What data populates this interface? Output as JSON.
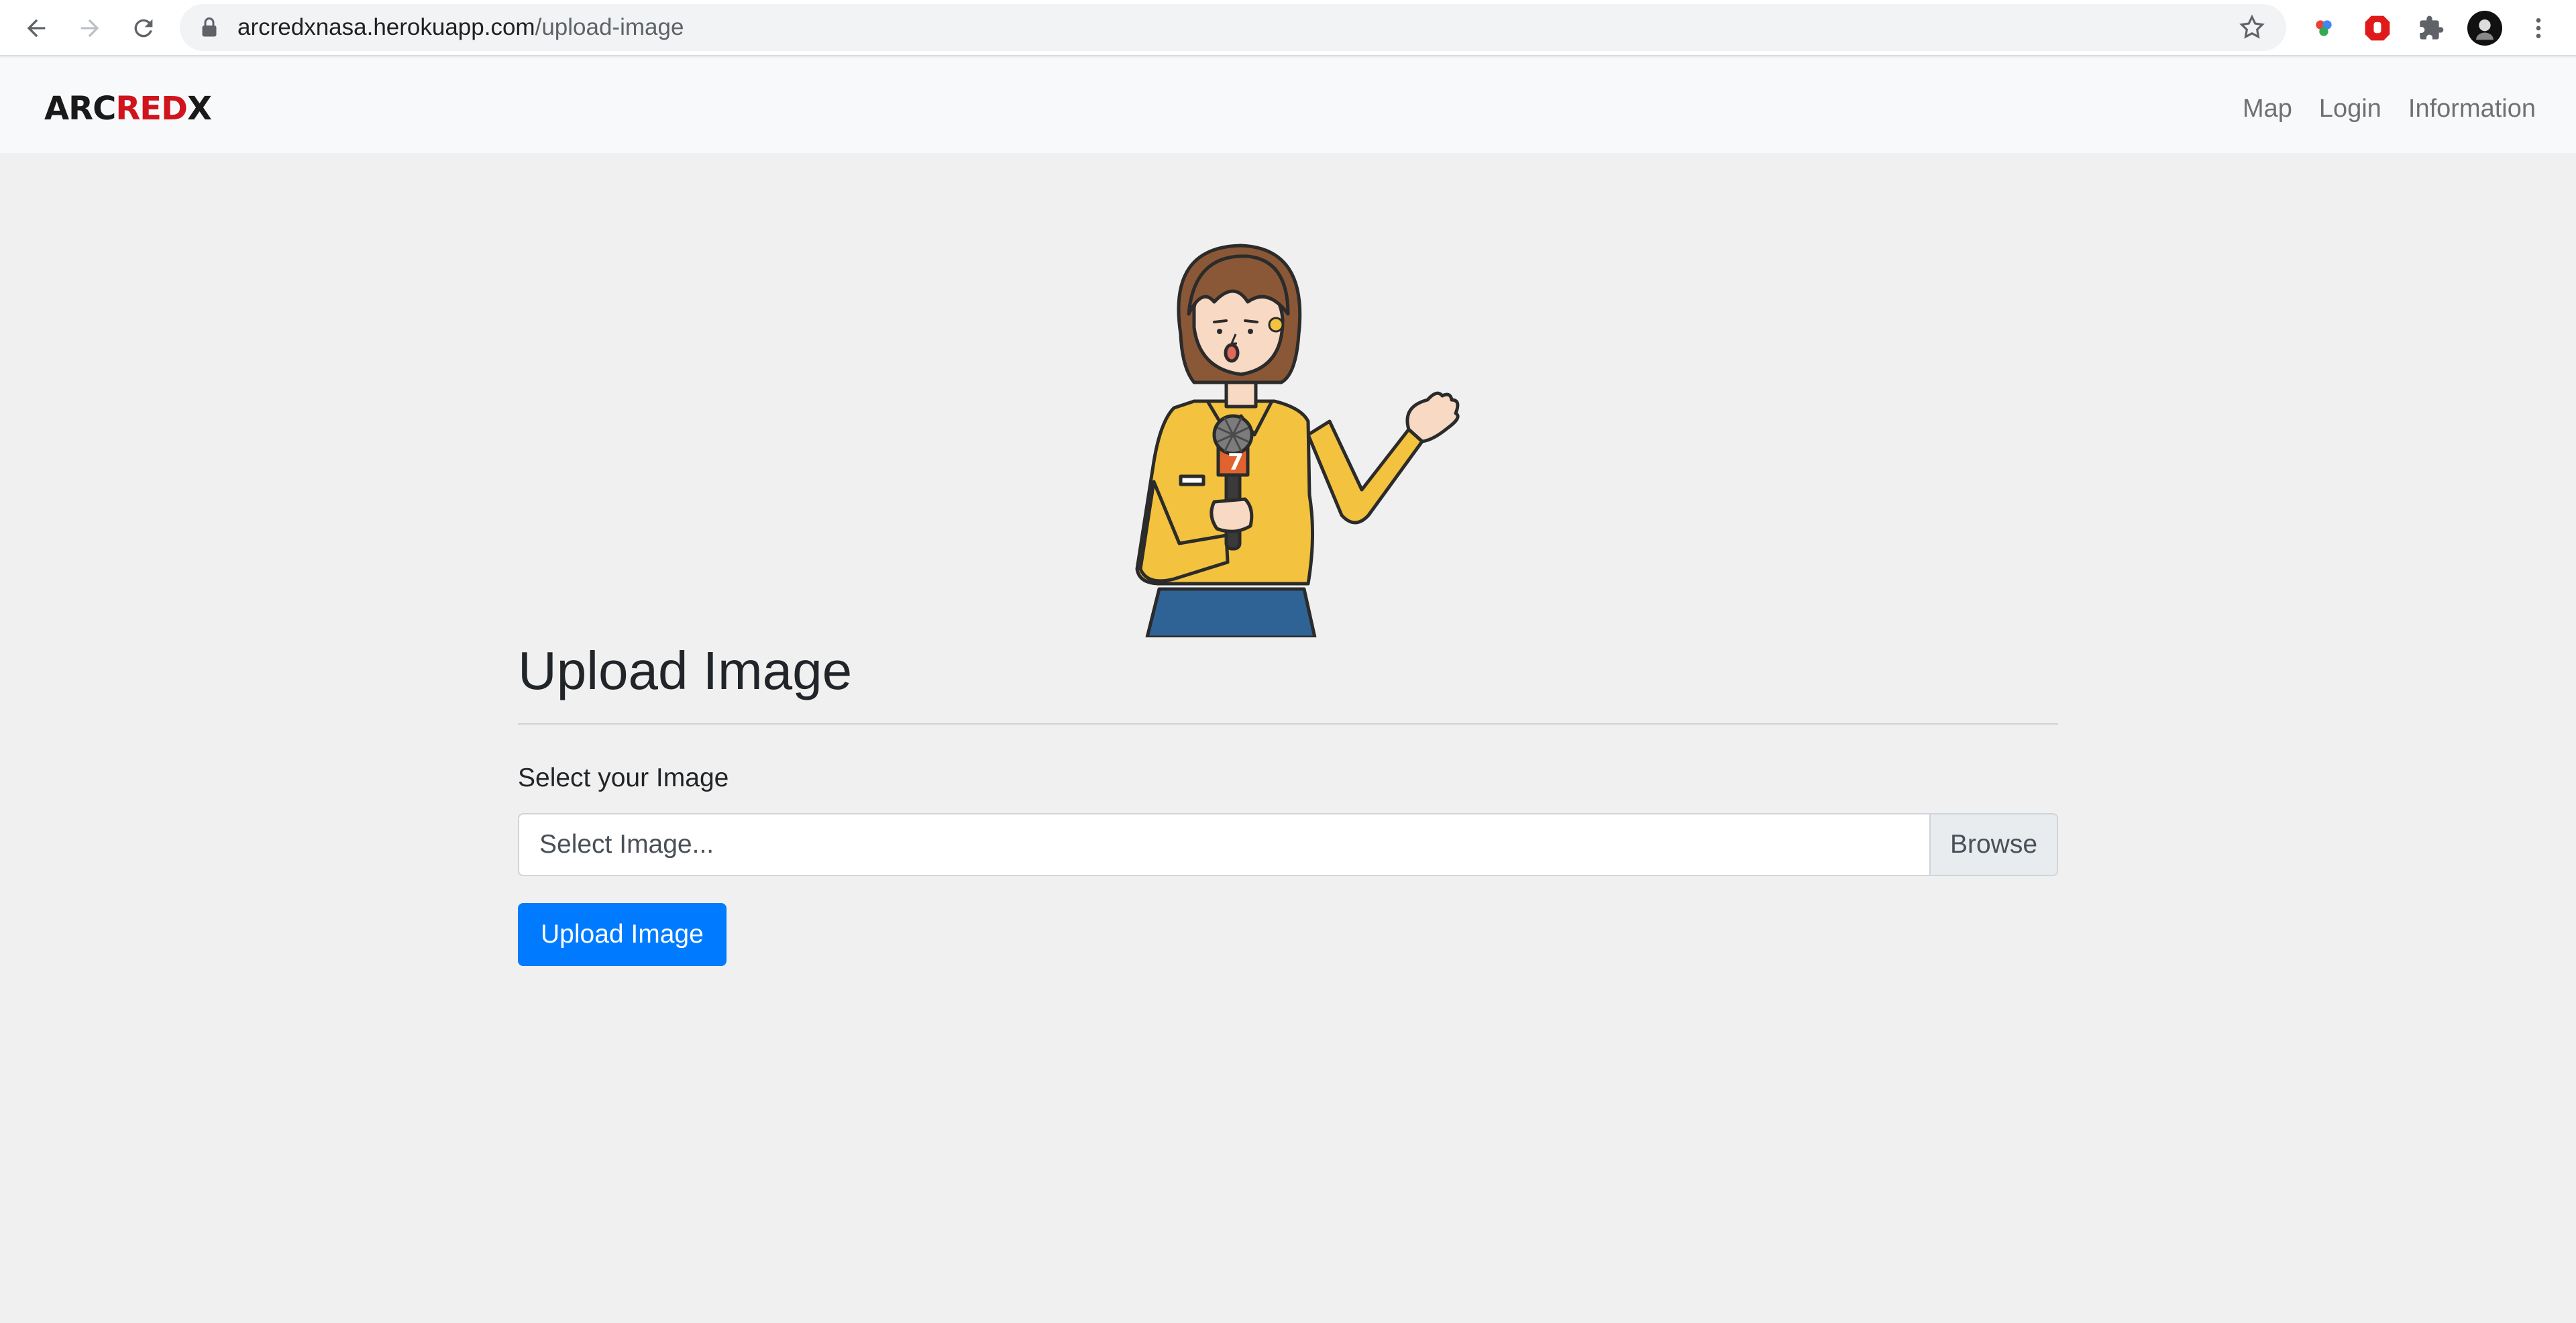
{
  "browser": {
    "url_domain": "arcredxnasa.herokuapp.com",
    "url_path": "/upload-image"
  },
  "navbar": {
    "brand_part1": "ARC",
    "brand_part2": "RED",
    "brand_part3": "X",
    "links": [
      "Map",
      "Login",
      "Information"
    ]
  },
  "main": {
    "title": "Upload Image",
    "file_label": "Select your Image",
    "file_placeholder": "Select Image...",
    "browse_label": "Browse",
    "upload_button": "Upload Image"
  },
  "colors": {
    "accent": "#007bff",
    "brand_red": "#d0141d",
    "background": "#f0f0f0"
  }
}
